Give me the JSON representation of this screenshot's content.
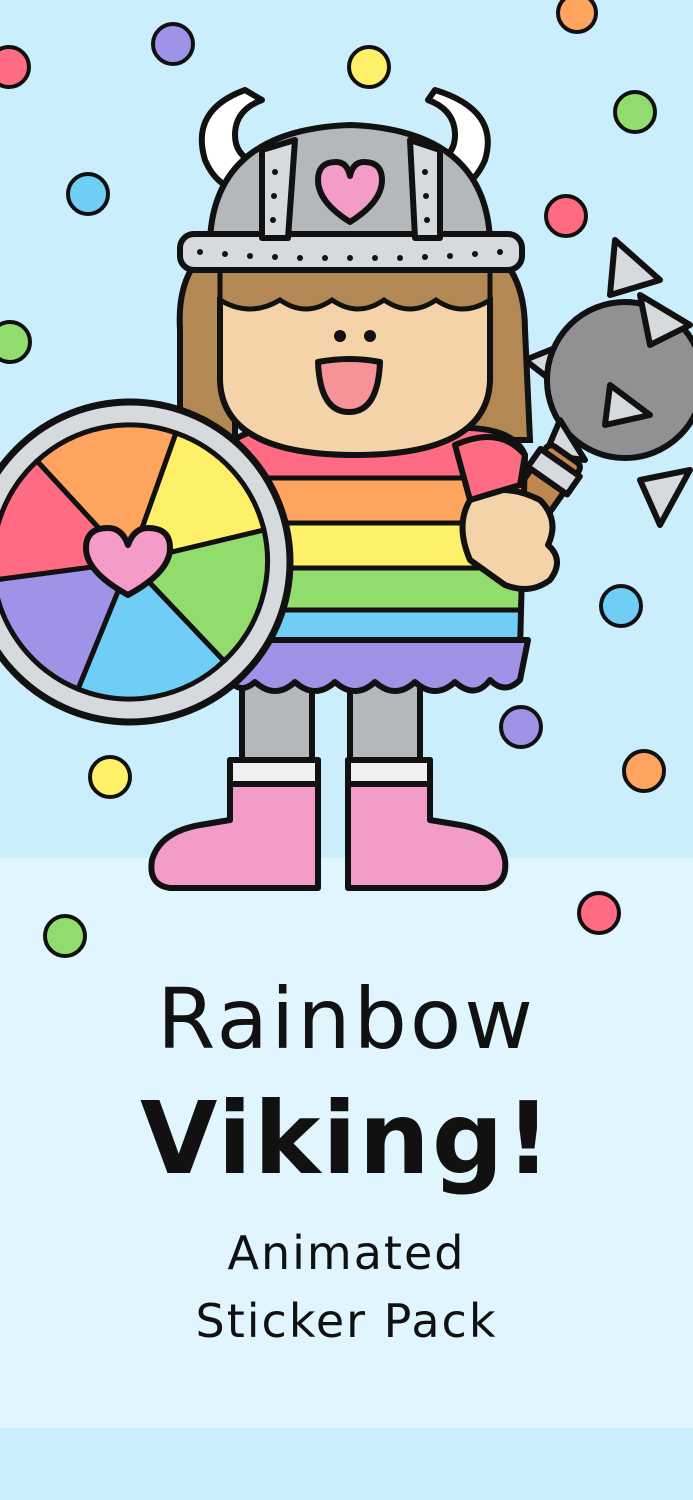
{
  "title": {
    "line1": "Rainbow",
    "line2": "Viking!"
  },
  "subtitle": {
    "line1": "Animated",
    "line2": "Sticker Pack"
  },
  "colors": {
    "background_top": "#cbeefd",
    "background_bottom": "#e0f5fe",
    "outline": "#111111",
    "helmet": "#b5b8bb",
    "horn": "#ffffff",
    "heart": "#f39cc8",
    "skin": "#f5d3a8",
    "hair": "#b48855",
    "mouth": "#f59399",
    "shirt_stripes": [
      "#ff6b83",
      "#ffa45f",
      "#fff06a",
      "#92dc6e",
      "#6fcdf6",
      "#9e93e6"
    ],
    "legs": "#b5b8bb",
    "boots": "#f39cc8",
    "mace_head": "#8f9193",
    "mace_handle": "#c08650",
    "shield_segments": [
      "#ffa45f",
      "#fff06a",
      "#92dc6e",
      "#6fcdf6",
      "#9e93e6",
      "#ff6b83"
    ],
    "confetti": [
      "#ff6b83",
      "#9e93e6",
      "#fff06a",
      "#ffa45f",
      "#92dc6e",
      "#6fcdf6"
    ]
  },
  "illustration": {
    "subject": "viking-girl-character",
    "items": [
      "horned-helmet-icon",
      "rainbow-shield-icon",
      "spiked-mace-icon",
      "heart-icon",
      "confetti-dots"
    ]
  }
}
